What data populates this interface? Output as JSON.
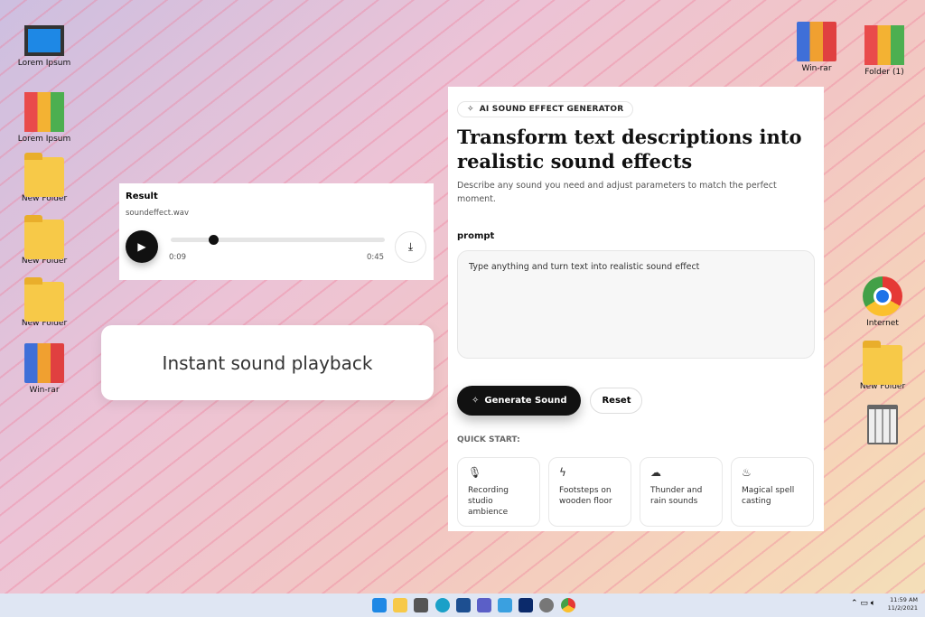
{
  "desktop": {
    "left": [
      "Lorem Ipsum",
      "Lorem Ipsum",
      "New Folder",
      "New Folder",
      "New Folder",
      "Win-rar"
    ],
    "right": [
      "Win-rar",
      "Folder (1)",
      "Internet",
      "New Folder"
    ]
  },
  "generator": {
    "badge": "AI SOUND EFFECT GENERATOR",
    "title": "Transform text descriptions into realistic sound effects",
    "description": "Describe any sound you need and adjust parameters to match the perfect moment.",
    "prompt_label": "prompt",
    "prompt_placeholder": "Type anything and turn text into realistic sound effect",
    "generate_label": "Generate Sound",
    "reset_label": "Reset",
    "quick_start_label": "QUICK START:",
    "quick_start": [
      {
        "icon": "microphone-icon",
        "label": "Recording studio ambience"
      },
      {
        "icon": "lightning-icon",
        "label": "Footsteps on wooden floor"
      },
      {
        "icon": "cloud-icon",
        "label": "Thunder and rain sounds"
      },
      {
        "icon": "flame-icon",
        "label": "Magical spell casting"
      }
    ]
  },
  "result": {
    "title": "Result",
    "filename": "soundeffect.wav",
    "current_time": "0:09",
    "duration": "0:45",
    "progress": 0.2
  },
  "callout": "Instant sound playback",
  "taskbar": {
    "time": "11:59 AM",
    "date": "11/2/2021"
  }
}
